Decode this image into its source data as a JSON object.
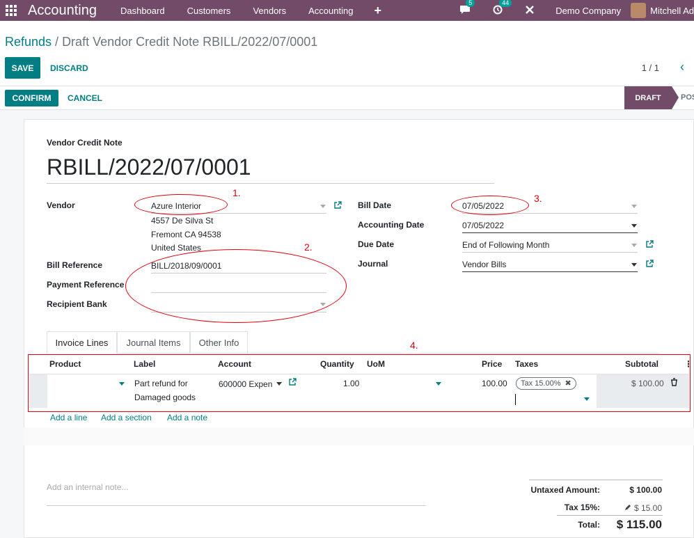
{
  "navbar": {
    "brand": "Accounting",
    "menu": [
      "Dashboard",
      "Customers",
      "Vendors",
      "Accounting"
    ],
    "plus": "+",
    "messages_badge": "5",
    "activities_badge": "44",
    "company": "Demo Company",
    "user": "Mitchell Ad"
  },
  "breadcrumb": {
    "parent": "Refunds",
    "separator": " / ",
    "current": "Draft Vendor Credit Note RBILL/2022/07/0001"
  },
  "actions": {
    "save": "SAVE",
    "discard": "DISCARD",
    "confirm": "CONFIRM",
    "cancel": "CANCEL"
  },
  "pager": {
    "value": "1 / 1",
    "prev": "‹"
  },
  "status": {
    "draft": "DRAFT",
    "posted": "POS"
  },
  "form": {
    "doc_type": "Vendor Credit Note",
    "name": "RBILL/2022/07/0001",
    "vendor_label": "Vendor",
    "vendor_value": "Azure Interior",
    "address_1": "4557 De Silva St",
    "address_2": "Fremont CA 94538",
    "address_3": "United States",
    "bill_ref_label": "Bill Reference",
    "bill_ref_value": "BILL/2018/09/0001",
    "payment_ref_label": "Payment Reference",
    "recipient_bank_label": "Recipient Bank",
    "bill_date_label": "Bill Date",
    "bill_date_value": "07/05/2022",
    "accounting_date_label": "Accounting Date",
    "accounting_date_value": "07/05/2022",
    "due_date_label": "Due Date",
    "due_date_value": "End of Following Month",
    "journal_label": "Journal",
    "journal_value": "Vendor Bills"
  },
  "annotations": [
    "1.",
    "2.",
    "3.",
    "4."
  ],
  "tabs": [
    "Invoice Lines",
    "Journal Items",
    "Other Info"
  ],
  "table": {
    "headers": {
      "product": "Product",
      "label": "Label",
      "account": "Account",
      "quantity": "Quantity",
      "uom": "UoM",
      "price": "Price",
      "taxes": "Taxes",
      "subtotal": "Subtotal"
    },
    "row": {
      "label_1": "Part refund for",
      "label_2": "Damaged goods",
      "account": "600000 Expen",
      "quantity": "1.00",
      "price": "100.00",
      "tax": "Tax 15.00%",
      "subtotal": "$ 100.00"
    },
    "add_line": "Add a line",
    "add_section": "Add a section",
    "add_note": "Add a note"
  },
  "note_placeholder": "Add an internal note...",
  "totals": {
    "untaxed_label": "Untaxed Amount:",
    "untaxed_value": "$ 100.00",
    "tax_label": "Tax 15%:",
    "tax_value": "$ 15.00",
    "total_label": "Total:",
    "total_value": "$ 115.00"
  },
  "colors": {
    "brand": "#714b67",
    "accent": "#017e84",
    "annotation": "#e3000f"
  }
}
